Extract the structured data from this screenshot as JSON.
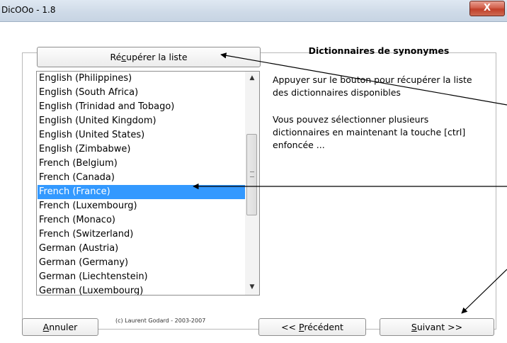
{
  "window": {
    "title": "DicOOo - 1.8",
    "close_glyph": "X"
  },
  "top_button": {
    "label_pre": "Ré",
    "label_ul": "c",
    "label_post": "upérer la liste"
  },
  "dictionary_list": {
    "items": [
      "English (Philippines)",
      "English (South Africa)",
      "English (Trinidad and Tobago)",
      "English (United Kingdom)",
      "English (United States)",
      "English (Zimbabwe)",
      "French (Belgium)",
      "French (Canada)",
      "French (France)",
      "French (Luxembourg)",
      "French (Monaco)",
      "French (Switzerland)",
      "German (Austria)",
      "German (Germany)",
      "German (Liechtenstein)",
      "German (Luxembourg)"
    ],
    "selected_index": 8
  },
  "info_panel": {
    "heading": "Dictionnaires de synonymes",
    "line1": "Appuyer sur le bouton pour récupérer la liste",
    "line2": "des dictionnaires disponibles",
    "line3": "Vous pouvez sélectionner plusieurs",
    "line4": "dictionnaires en maintenant la touche [ctrl]",
    "line5": "enfoncée ..."
  },
  "footer": {
    "cancel_ul": "A",
    "cancel_post": "nnuler",
    "copyright": "(c) Laurent Godard - 2003-2007",
    "prev_pre": "<< ",
    "prev_ul": "P",
    "prev_post": "récédent",
    "next_ul": "S",
    "next_post": "uivant >>"
  },
  "colors": {
    "selection": "#3399ff",
    "close_button": "#c1402a"
  }
}
